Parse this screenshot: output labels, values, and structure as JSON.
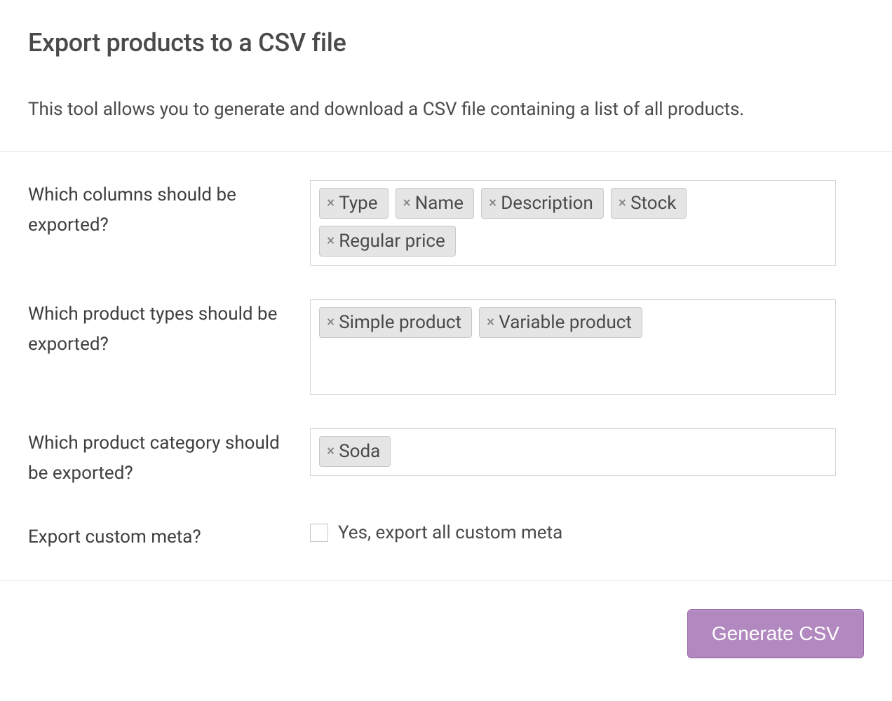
{
  "header": {
    "title": "Export products to a CSV file",
    "description": "This tool allows you to generate and download a CSV file containing a list of all products."
  },
  "form": {
    "columns": {
      "label": "Which columns should be exported?",
      "tags": [
        "Type",
        "Name",
        "Description",
        "Stock",
        "Regular price"
      ]
    },
    "product_types": {
      "label": "Which product types should be exported?",
      "tags": [
        "Simple product",
        "Variable product"
      ]
    },
    "category": {
      "label": "Which product category should be exported?",
      "tags": [
        "Soda"
      ]
    },
    "custom_meta": {
      "label": "Export custom meta?",
      "checkbox_label": "Yes, export all custom meta",
      "checked": false
    }
  },
  "footer": {
    "generate_button": "Generate CSV"
  },
  "icons": {
    "remove": "×"
  }
}
